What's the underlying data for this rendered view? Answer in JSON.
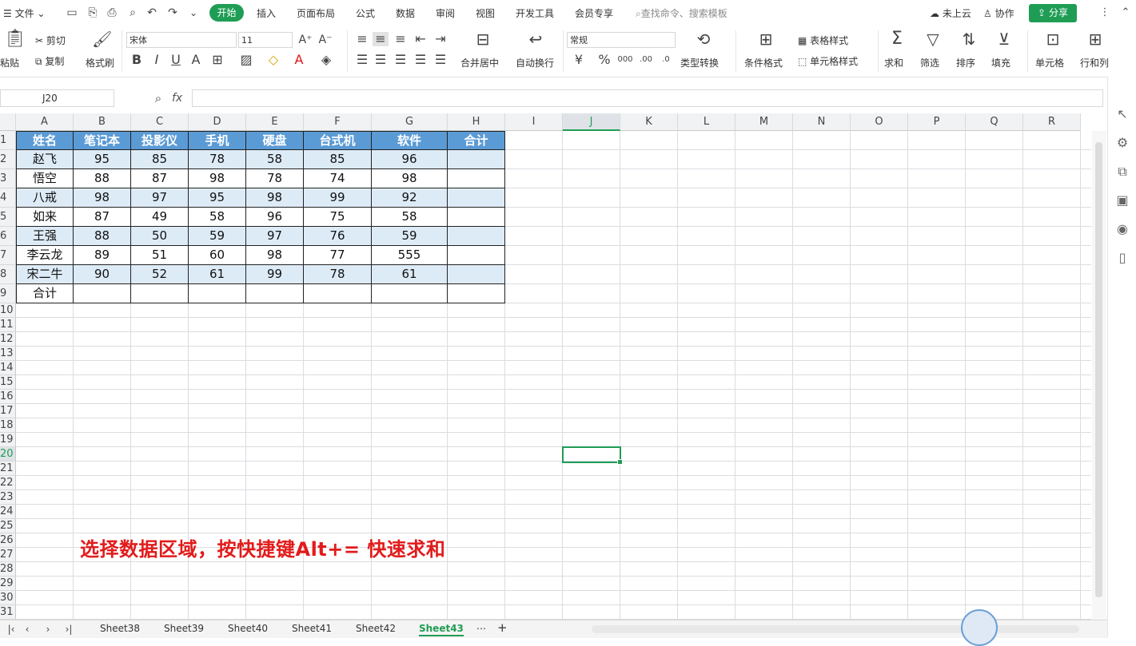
{
  "menubar": {
    "file": "文件",
    "tabs": [
      "开始",
      "插入",
      "页面布局",
      "公式",
      "数据",
      "审阅",
      "视图",
      "开发工具",
      "会员专享"
    ],
    "search": "查找命令、搜索模板",
    "cloud": "未上云",
    "collab": "协作",
    "share": "分享"
  },
  "ribbon": {
    "paste": "粘贴",
    "cut": "剪切",
    "copy": "复制",
    "format_painter": "格式刷",
    "font": "宋体",
    "size": "11",
    "merge": "合并居中",
    "wrap": "自动换行",
    "number_format": "常规",
    "type_convert": "类型转换",
    "cond_format": "条件格式",
    "table_style": "表格样式",
    "cell_style": "单元格样式",
    "sum": "求和",
    "filter": "筛选",
    "sort": "排序",
    "fill": "填充",
    "cell": "单元格",
    "row_col": "行和列"
  },
  "formula_bar": {
    "name_box": "J20",
    "fx": "fx",
    "formula": ""
  },
  "columns": [
    "A",
    "B",
    "C",
    "D",
    "E",
    "F",
    "G",
    "H",
    "I",
    "J",
    "K",
    "L",
    "M",
    "N",
    "O",
    "P",
    "Q",
    "R"
  ],
  "active_column": "J",
  "active_row": "20",
  "rows": [
    "1",
    "2",
    "3",
    "4",
    "5",
    "6",
    "7",
    "8",
    "9",
    "10",
    "11",
    "12",
    "13",
    "14",
    "15",
    "16",
    "17",
    "18",
    "19",
    "20",
    "21",
    "22",
    "23",
    "24",
    "25",
    "26",
    "27",
    "28",
    "29",
    "30",
    "31"
  ],
  "table": {
    "header": [
      "姓名",
      "笔记本",
      "投影仪",
      "手机",
      "硬盘",
      "台式机",
      "软件",
      "合计"
    ],
    "data": [
      [
        "赵飞",
        "95",
        "85",
        "78",
        "58",
        "85",
        "96",
        ""
      ],
      [
        "悟空",
        "88",
        "87",
        "98",
        "78",
        "74",
        "98",
        ""
      ],
      [
        "八戒",
        "98",
        "97",
        "95",
        "98",
        "99",
        "92",
        ""
      ],
      [
        "如来",
        "87",
        "49",
        "58",
        "96",
        "75",
        "58",
        ""
      ],
      [
        "王强",
        "88",
        "50",
        "59",
        "97",
        "76",
        "59",
        ""
      ],
      [
        "李云龙",
        "89",
        "51",
        "60",
        "98",
        "77",
        "555",
        ""
      ],
      [
        "宋二牛",
        "90",
        "52",
        "61",
        "99",
        "78",
        "61",
        ""
      ],
      [
        "合计",
        "",
        "",
        "",
        "",
        "",
        "",
        ""
      ]
    ]
  },
  "caption": "选择数据区域，按快捷键Alt+= 快速求和",
  "sheets": [
    "Sheet38",
    "Sheet39",
    "Sheet40",
    "Sheet41",
    "Sheet42",
    "Sheet43"
  ],
  "active_sheet": "Sheet43",
  "more_sheets": "⋯",
  "add_sheet": "+",
  "colors": {
    "accent": "#1f9d55",
    "header_fill": "#5b9bd5",
    "band_fill": "#ddebf7",
    "caption": "#e21b1b"
  }
}
